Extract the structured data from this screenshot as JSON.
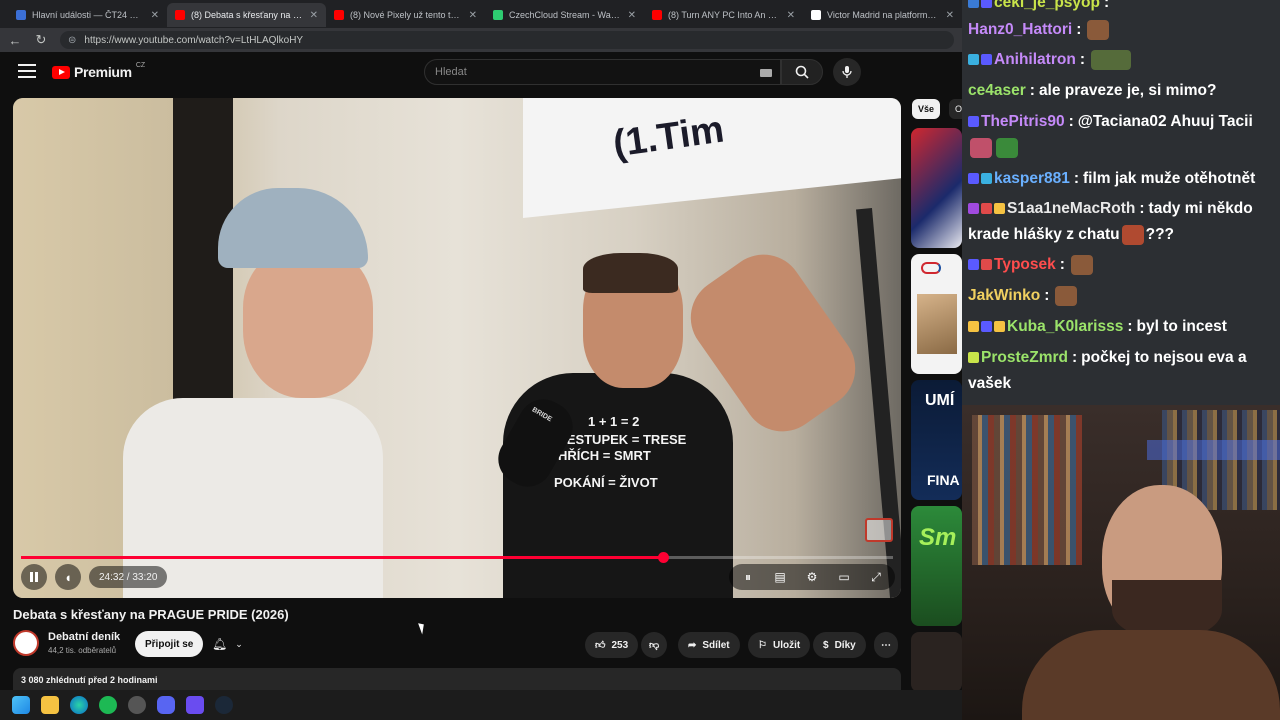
{
  "browser": {
    "tabs": [
      {
        "label": "Hlavní události — ČT24 — Česká",
        "favicon_color": "#3b6fd6",
        "active": false
      },
      {
        "label": "(8) Debata s křesťany na PRA",
        "favicon_color": "#ff0000",
        "active": true
      },
      {
        "label": "(8) Nové Pixely už tento týden.. | R",
        "favicon_color": "#ff0000",
        "active": false
      },
      {
        "label": "CzechCloud Stream - Watch Live o",
        "favicon_color": "#2ecc71",
        "active": false
      },
      {
        "label": "(8) Turn ANY PC Into An Xbox! HU",
        "favicon_color": "#ff0000",
        "active": false
      },
      {
        "label": "Victor Madrid na platformě X: „@t",
        "favicon_color": "#ffffff",
        "active": false
      }
    ],
    "tab_close": "✕",
    "url": "https://www.youtube.com/watch?v=LtHLAQlkoHY"
  },
  "youtube": {
    "logo_text": "Premium",
    "logo_country": "CZ",
    "search_placeholder": "Hledat",
    "video": {
      "title": "Debata s křesťany na PRAGUE PRIDE (2026)",
      "time": "24:32 / 33:20",
      "progress": 0.736,
      "banner_text": "(1.Tim",
      "shirt_lines": [
        "1 + 1 = 2",
        "KŘESTUPEK = TRESE",
        "HŘÍCH = SMRT",
        "POKÁNÍ = ŽIVOT"
      ],
      "mic_label": "BRIDE"
    },
    "channel": {
      "name": "Debatní deník",
      "subscribers": "44,2 tis. odběratelů",
      "join_label": "Připojit se"
    },
    "actions": {
      "likes": "253",
      "share_label": "Sdílet",
      "save_label": "Uložit",
      "thanks_label": "Díky",
      "more": "⋯"
    },
    "description_meta": "3 080 zhlédnutí  před 2 hodinami",
    "suggestions": {
      "chip_all": "Vše",
      "chip_second": "O",
      "thumb_texts": [
        "",
        "",
        "UMÍ",
        "FINA",
        "Sm"
      ]
    }
  },
  "chat": {
    "messages": [
      {
        "user": "ceki_je_psyop",
        "user_color": "#c9e44a",
        "text": ""
      },
      {
        "user": "Hanz0_Hattori",
        "user_color": "#c58af9",
        "text": ""
      },
      {
        "user": "Anihilatron",
        "user_color": "#c58af9",
        "text": ""
      },
      {
        "user": "ce4aser",
        "user_color": "#9be36a",
        "text": "ale praveze je, si mimo?"
      },
      {
        "user": "ThePitris90",
        "user_color": "#c58af9",
        "text": "@Taciana02 Ahuuj Tacii"
      },
      {
        "user": "kasper881",
        "user_color": "#6ab0ff",
        "text": "film jak muže otěhotnět"
      },
      {
        "user": "S1aa1neMacRoth",
        "user_color": "#e8e8e8",
        "text": "tady mi někdo krade hlášky z chatu",
        "text_end": "???"
      },
      {
        "user": "Typosek",
        "user_color": "#ff4d4d",
        "text": ""
      },
      {
        "user": "JakWinko",
        "user_color": "#f0d060",
        "text": ""
      },
      {
        "user": "Kuba_K0larisss",
        "user_color": "#9be36a",
        "text": "byl to incest"
      },
      {
        "user": "ProsteZmrd",
        "user_color": "#9be36a",
        "text": "počkej to nejsou eva a vašek"
      }
    ],
    "separator": ":"
  },
  "colors": {
    "yt_red": "#ff0033",
    "background": "#0f0f0f",
    "chat_bg": "#2c2f33"
  }
}
